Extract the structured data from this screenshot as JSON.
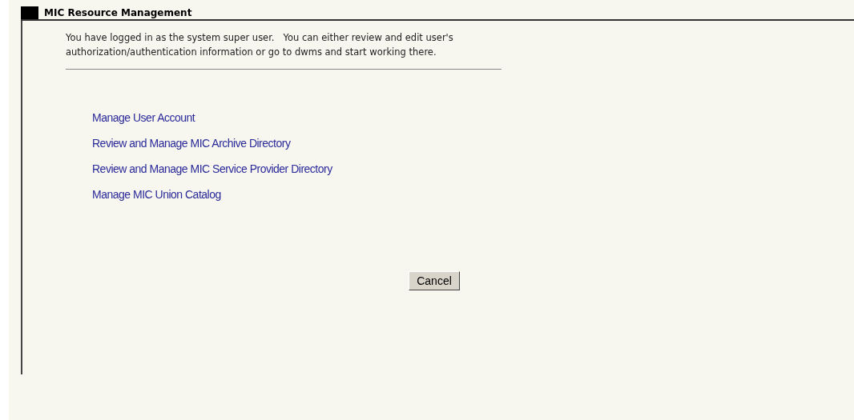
{
  "panel": {
    "title": "MIC Resource Management"
  },
  "intro": "You have logged in as the system super user.   You can either review and edit user's authorization/authentication information or go to dwms and start working there.",
  "links": [
    "Manage User Account",
    "Review and Manage MIC Archive Directory",
    "Review and Manage MIC Service Provider Directory",
    "Manage MIC Union Catalog"
  ],
  "buttons": [
    "Cancel"
  ]
}
